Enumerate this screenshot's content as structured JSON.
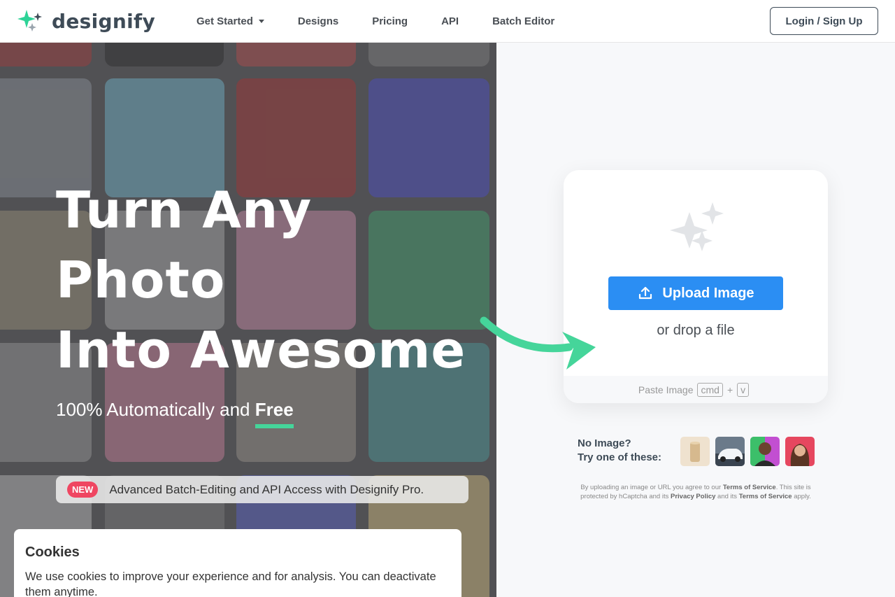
{
  "header": {
    "brand": "designify",
    "nav": [
      {
        "label": "Get Started",
        "has_caret": true
      },
      {
        "label": "Designs"
      },
      {
        "label": "Pricing"
      },
      {
        "label": "API"
      },
      {
        "label": "Batch Editor"
      }
    ],
    "login_label": "Login / Sign Up"
  },
  "hero": {
    "title_lines": [
      "Turn Any",
      "Photo",
      "Into Awesome"
    ],
    "subtitle_prefix": "100% Automatically and ",
    "subtitle_emphasis": "Free",
    "promo_badge": "NEW",
    "promo_text": "Advanced Batch-Editing and API Access with Designify Pro."
  },
  "cookie": {
    "title": "Cookies",
    "text": "We use cookies to improve your experience and for analysis. You can deactivate them anytime."
  },
  "upload": {
    "button_label": "Upload Image",
    "drop_text": "or drop a file",
    "paste_label": "Paste Image",
    "key_cmd": "cmd",
    "key_plus": "+",
    "key_v": "v"
  },
  "samples": {
    "label_line1": "No Image?",
    "label_line2": "Try one of these:",
    "items": [
      "sample-cylinder",
      "sample-car",
      "sample-man",
      "sample-woman"
    ]
  },
  "terms": {
    "part1": "By uploading an image or URL you agree to our ",
    "tos1": "Terms of Service",
    "part2": ". This site is protected by hCaptcha and its ",
    "privacy": "Privacy Policy",
    "part3": " and its ",
    "tos2": "Terms of Service",
    "part4": " apply."
  },
  "colors": {
    "accent_blue": "#2b8ef3",
    "accent_green": "#45d59a",
    "badge_red": "#ef4661",
    "brand_dark": "#3e4b57"
  }
}
